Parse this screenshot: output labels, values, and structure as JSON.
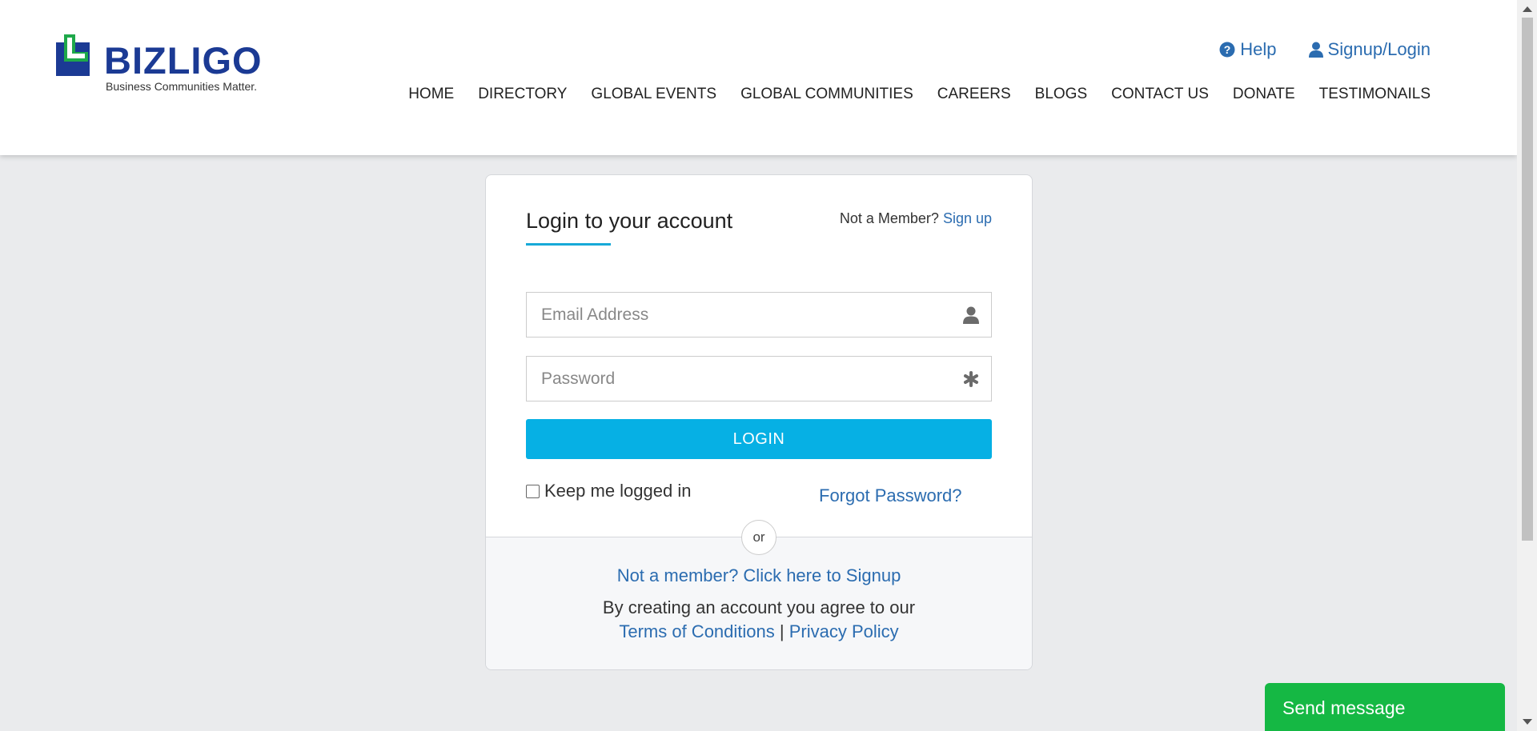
{
  "header": {
    "logo_text": "BIZLIGO",
    "logo_tagline": "Business Communities Matter.",
    "top_links": {
      "help": "Help",
      "signup_login": "Signup/Login"
    },
    "nav": [
      "HOME",
      "DIRECTORY",
      "GLOBAL EVENTS",
      "GLOBAL COMMUNITIES",
      "CAREERS",
      "BLOGS",
      "CONTACT US",
      "DONATE",
      "TESTIMONAILS"
    ]
  },
  "login_card": {
    "title": "Login to your account",
    "not_member_prefix": "Not a Member?",
    "sign_up_link": "Sign up",
    "email_placeholder": "Email Address",
    "password_placeholder": "Password",
    "login_button": "LOGIN",
    "keep_logged_in": "Keep me logged in",
    "forgot_password": "Forgot Password?",
    "or_label": "or",
    "signup_prompt": "Not a member? Click here to Signup",
    "agree_text": "By creating an account you agree to our",
    "terms_link": "Terms of Conditions",
    "separator": "|",
    "privacy_link": "Privacy Policy"
  },
  "chat_widget": {
    "label": "Send message"
  },
  "colors": {
    "brand_blue": "#1b3a94",
    "brand_green": "#1ea84a",
    "link_blue": "#2b6cb0",
    "login_button": "#06b0e4",
    "send_message": "#15b844",
    "page_bg": "#eaebed"
  },
  "icons": {
    "help": "question-circle-icon",
    "signup_login": "user-icon",
    "email_field": "user-icon",
    "password_field": "asterisk-icon"
  }
}
